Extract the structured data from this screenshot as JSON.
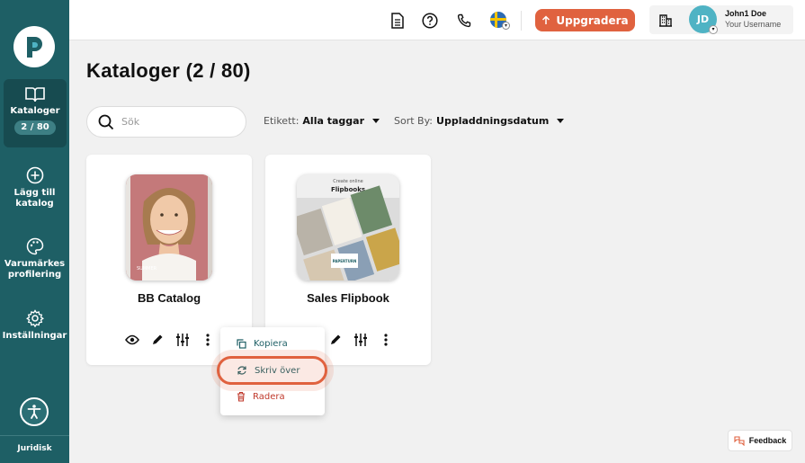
{
  "sidebar": {
    "items": [
      {
        "label": "Kataloger",
        "badge": "2 / 80",
        "icon": "open-book-icon"
      },
      {
        "label": "Lägg till katalog",
        "icon": "plus-circle-icon"
      },
      {
        "label": "Varumärkes profilering",
        "icon": "palette-icon"
      },
      {
        "label": "Inställningar",
        "icon": "gear-icon"
      }
    ],
    "footer_label": "Juridisk"
  },
  "header": {
    "upgrade_label": "Uppgradera",
    "user_initials": "JD",
    "user_name": "John1 Doe",
    "user_sub": "Your Username"
  },
  "main": {
    "title": "Kataloger (2 / 80)",
    "search_placeholder": "Sök",
    "filter_tag_label": "Etikett:",
    "filter_tag_value": "Alla taggar",
    "sort_label": "Sort By:",
    "sort_value": "Uppladdningsdatum",
    "cards": [
      {
        "title": "BB Catalog"
      },
      {
        "title": "Sales Flipbook",
        "cover_title": "Create online",
        "cover_sub": "Flipbooks",
        "cover_brand": "PAPERTURN"
      }
    ]
  },
  "menu": {
    "items": [
      {
        "label": "Kopiera"
      },
      {
        "label": "Skriv över"
      },
      {
        "label": "Radera"
      }
    ]
  },
  "feedback_label": "Feedback",
  "colors": {
    "sidebar": "#1e5f65",
    "accent": "#e0623f",
    "avatar": "#4fb3c4",
    "danger": "#c0392b"
  }
}
